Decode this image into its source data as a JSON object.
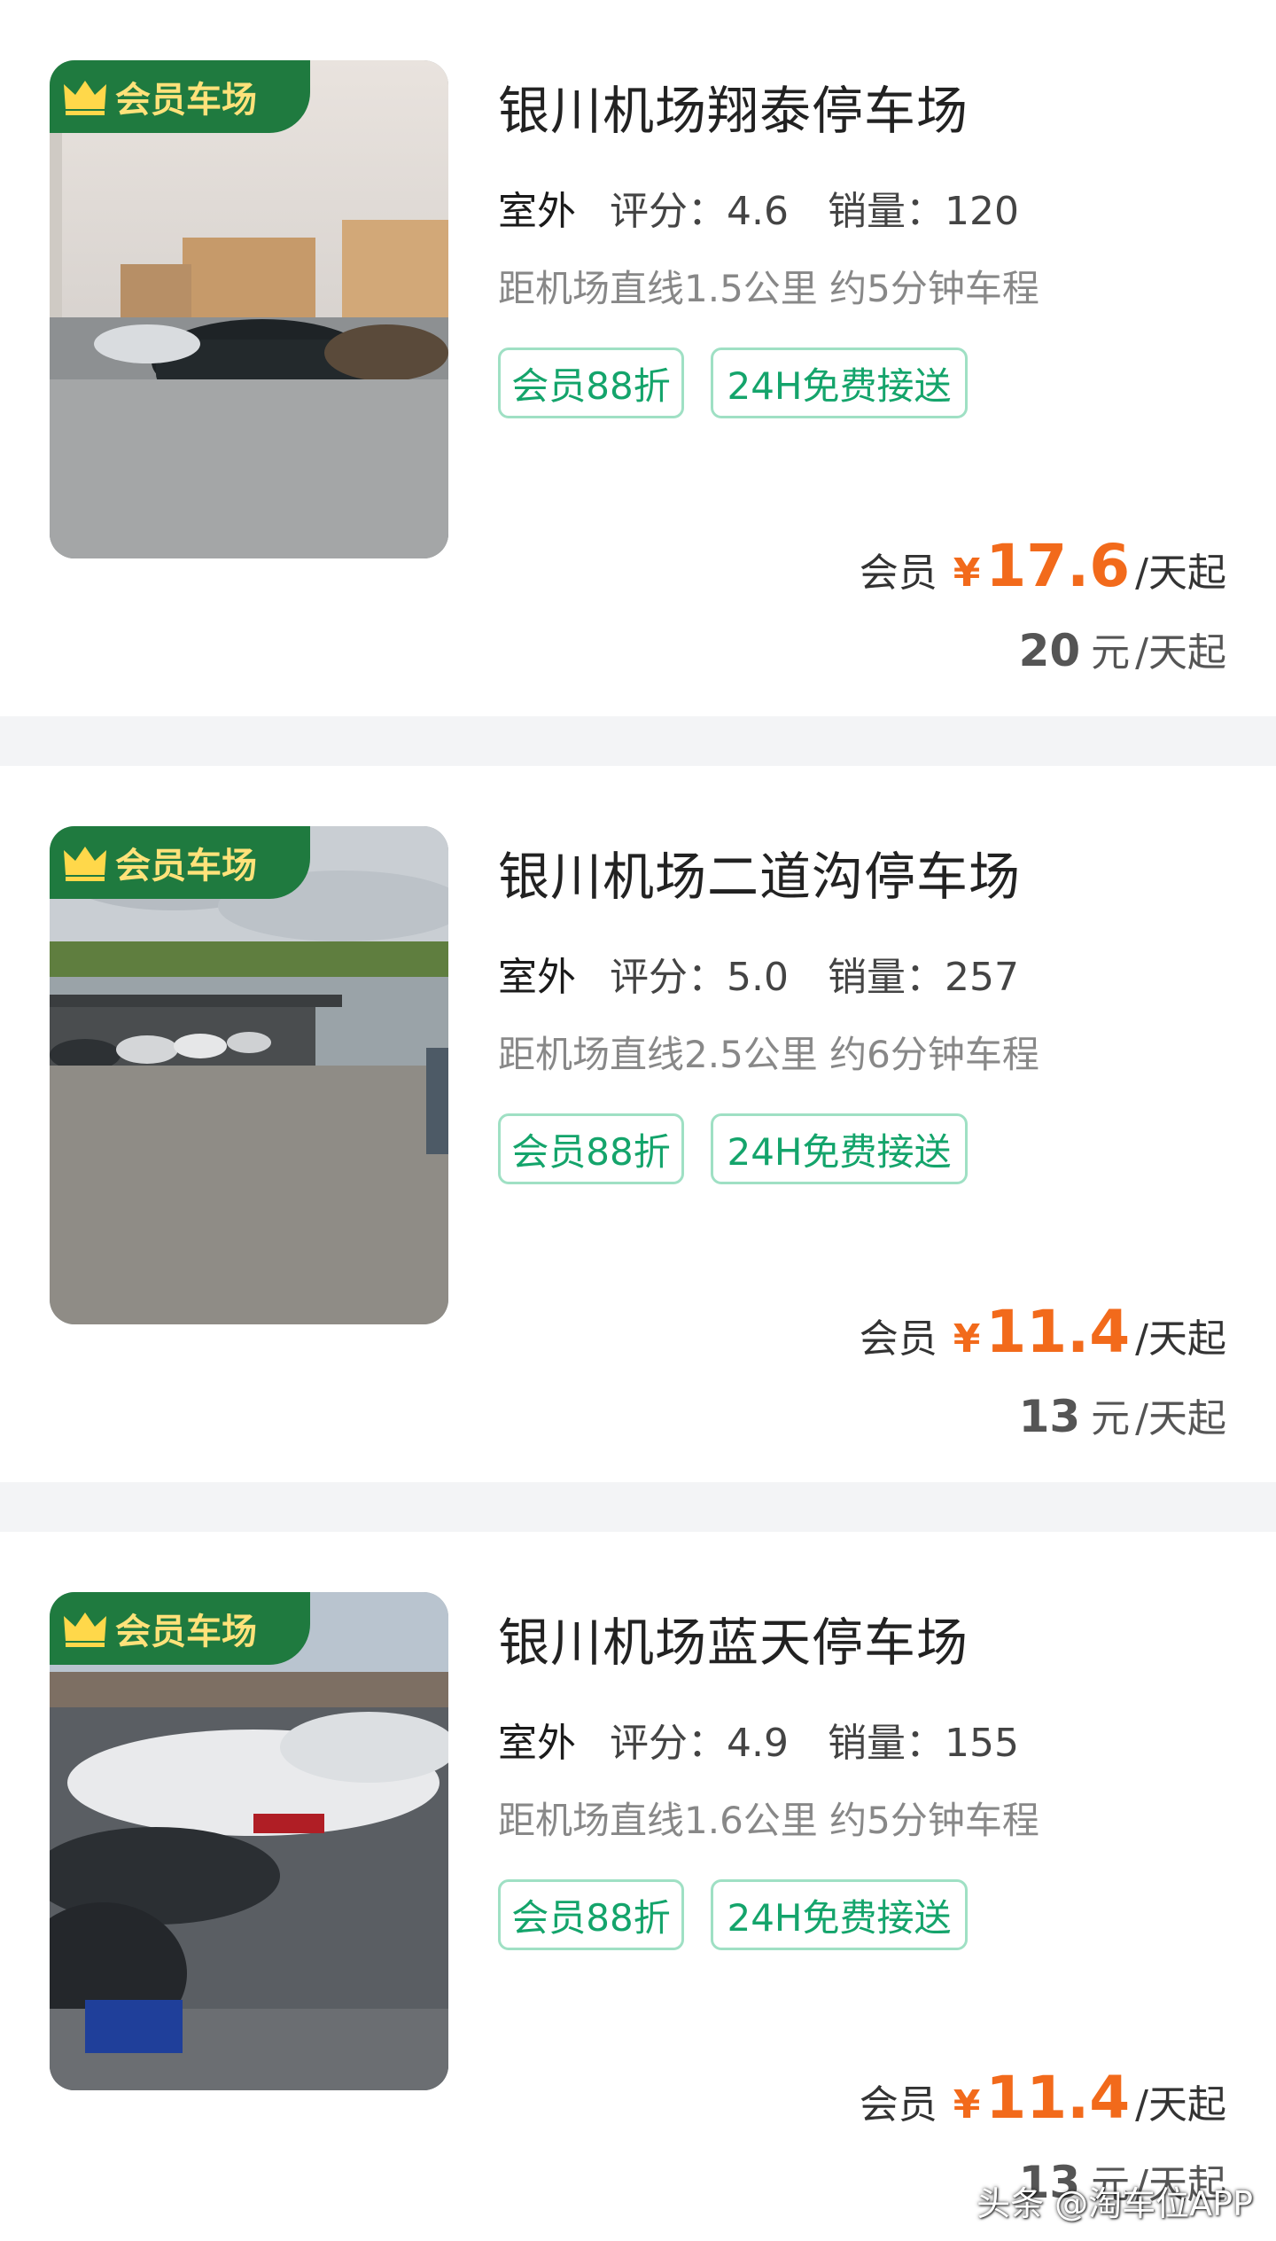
{
  "colors": {
    "accent_green": "#1f7a3f",
    "tag_green": "#14a46b",
    "price_orange": "#f26a1b",
    "badge_text": "#ffe27a"
  },
  "parking_lots": [
    {
      "badge": "会员车场",
      "title": "银川机场翔泰停车场",
      "type": "室外",
      "rating_label": "评分：",
      "rating": "4.6",
      "sales_label": "销量：",
      "sales": "120",
      "distance": "距机场直线1.5公里 约5分钟车程",
      "tags": [
        "会员88折",
        "24H免费接送"
      ],
      "member_label": "会员",
      "currency": "¥",
      "member_price": "17.6",
      "per_day": "/天起",
      "normal_price": "20",
      "yuan": "元"
    },
    {
      "badge": "会员车场",
      "title": "银川机场二道沟停车场",
      "type": "室外",
      "rating_label": "评分：",
      "rating": "5.0",
      "sales_label": "销量：",
      "sales": "257",
      "distance": "距机场直线2.5公里 约6分钟车程",
      "tags": [
        "会员88折",
        "24H免费接送"
      ],
      "member_label": "会员",
      "currency": "¥",
      "member_price": "11.4",
      "per_day": "/天起",
      "normal_price": "13",
      "yuan": "元"
    },
    {
      "badge": "会员车场",
      "title": "银川机场蓝天停车场",
      "type": "室外",
      "rating_label": "评分：",
      "rating": "4.9",
      "sales_label": "销量：",
      "sales": "155",
      "distance": "距机场直线1.6公里 约5分钟车程",
      "tags": [
        "会员88折",
        "24H免费接送"
      ],
      "member_label": "会员",
      "currency": "¥",
      "member_price": "11.4",
      "per_day": "/天起",
      "normal_price": "13",
      "yuan": "元"
    }
  ],
  "watermark": "头条 @淘车位APP"
}
